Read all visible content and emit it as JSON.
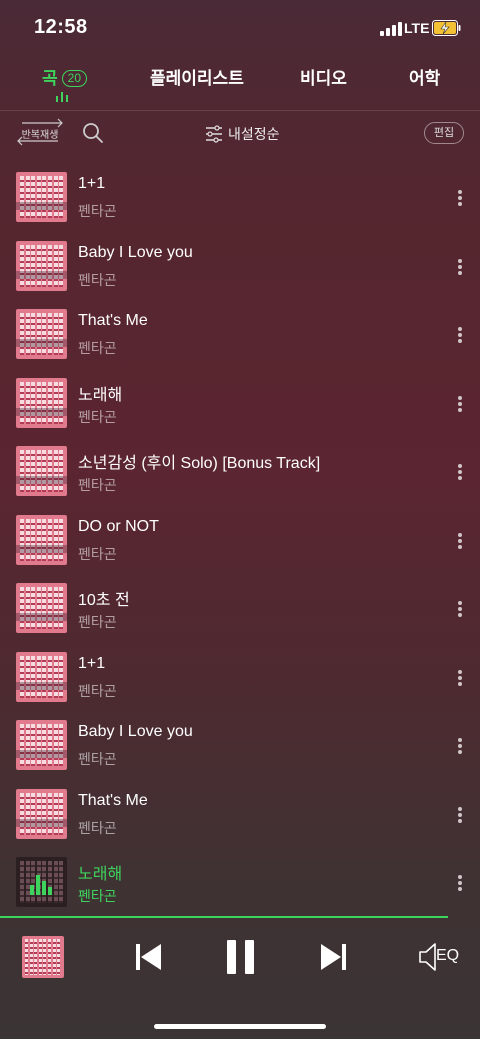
{
  "status": {
    "time": "12:58",
    "network": "LTE"
  },
  "tabs": [
    {
      "label": "곡",
      "count": "20",
      "active": true
    },
    {
      "label": "플레이리스트"
    },
    {
      "label": "비디오"
    },
    {
      "label": "어학"
    }
  ],
  "toolbar": {
    "repeat_label": "반복재생",
    "sort_label": "내설정순",
    "edit_label": "편집"
  },
  "songs": [
    {
      "title": "1+1",
      "artist": "펜타곤"
    },
    {
      "title": "Baby I Love you",
      "artist": "펜타곤"
    },
    {
      "title": "That's Me",
      "artist": "펜타곤"
    },
    {
      "title": "노래해",
      "artist": "펜타곤"
    },
    {
      "title": "소년감성 (후이 Solo) [Bonus Track]",
      "artist": "펜타곤"
    },
    {
      "title": "DO or NOT",
      "artist": "펜타곤"
    },
    {
      "title": "10초 전",
      "artist": "펜타곤"
    },
    {
      "title": "1+1",
      "artist": "펜타곤"
    },
    {
      "title": "Baby I Love you",
      "artist": "펜타곤"
    },
    {
      "title": "That's Me",
      "artist": "펜타곤"
    },
    {
      "title": "노래해",
      "artist": "펜타곤",
      "playing": true
    }
  ],
  "player": {
    "eq_label": "EQ",
    "state": "playing"
  },
  "colors": {
    "accent": "#3ed35c",
    "album_art": "#e07a8c"
  },
  "icons": [
    "signal-icon",
    "battery-charging-icon",
    "repeat-icon",
    "search-icon",
    "sort-icon",
    "more-icon",
    "previous-icon",
    "pause-icon",
    "next-icon",
    "eq-speaker-icon"
  ]
}
